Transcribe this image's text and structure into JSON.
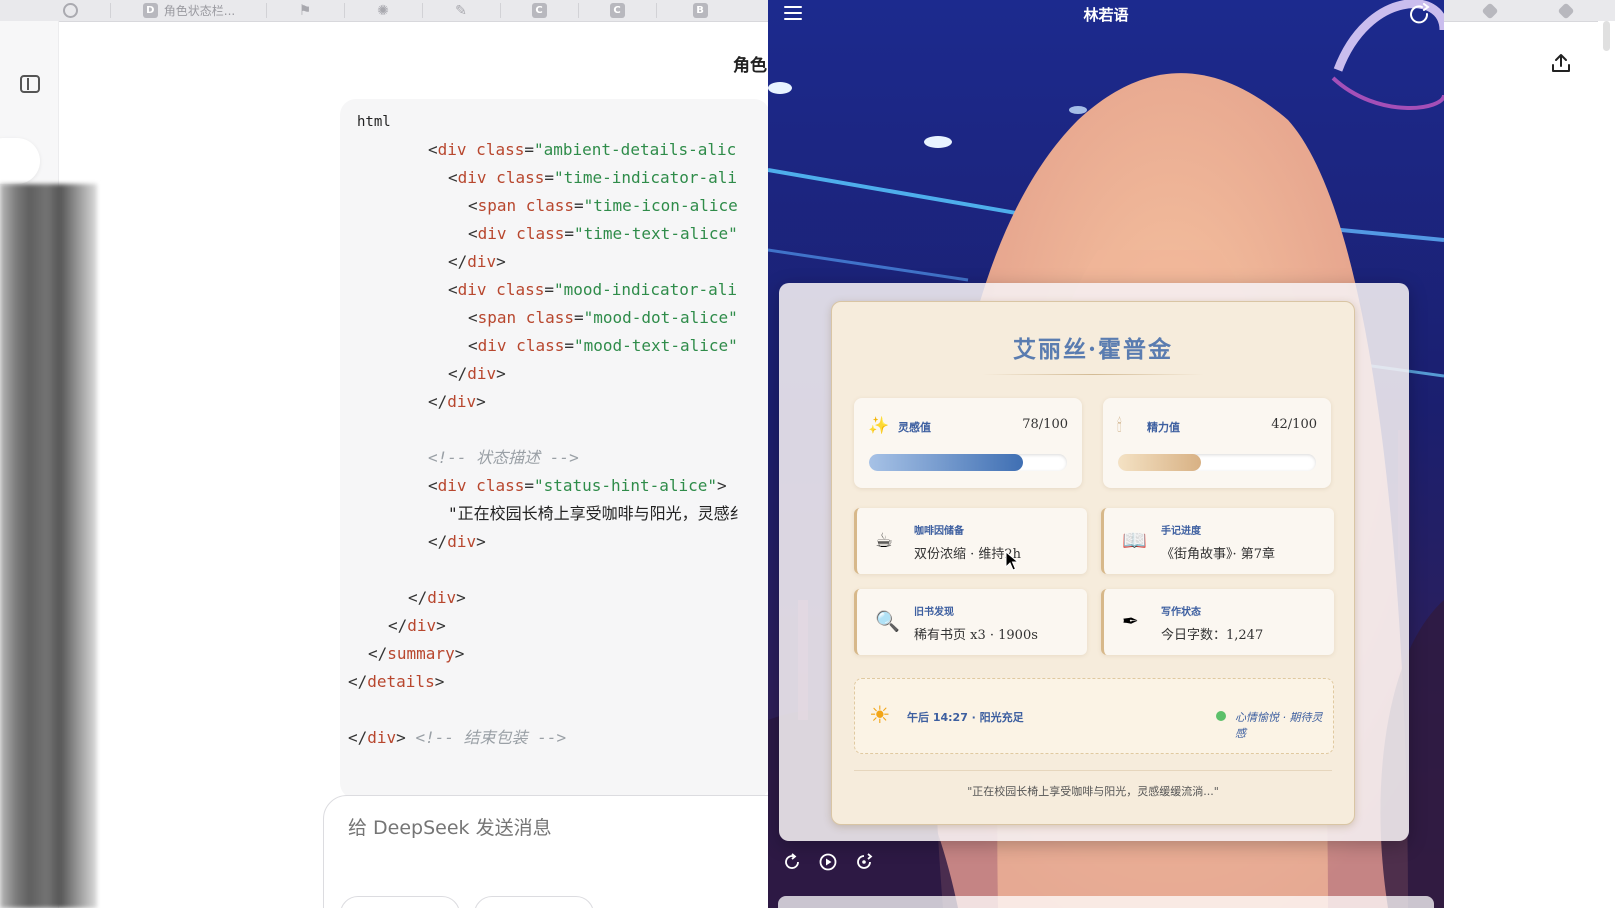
{
  "tabs": [
    {
      "icon": "openai-icon",
      "glyph": "",
      "label": ""
    },
    {
      "icon": "doc-tab-icon",
      "glyph": "D",
      "label": "角色状态栏..."
    },
    {
      "icon": "flag-icon",
      "glyph": "⚑",
      "label": ""
    },
    {
      "icon": "sparkle-icon",
      "glyph": "✺",
      "label": ""
    },
    {
      "icon": "app-icon",
      "glyph": "✎",
      "label": ""
    },
    {
      "icon": "c-tab-icon",
      "glyph": "C",
      "label": ""
    },
    {
      "icon": "c-tab-icon-2",
      "glyph": "C",
      "label": ""
    },
    {
      "icon": "b-tab-icon",
      "glyph": "B",
      "label": ""
    }
  ],
  "chat": {
    "title": "角色",
    "code_language": "html",
    "composer_placeholder": "给 DeepSeek 发送消息"
  },
  "code_lines": [
    {
      "indent": 4,
      "parts": [
        {
          "t": "punc",
          "v": "<"
        },
        {
          "t": "tag",
          "v": "div"
        },
        {
          "t": "attr",
          "v": " class"
        },
        {
          "t": "punc",
          "v": "="
        },
        {
          "t": "str",
          "v": "\"ambient-details-alic"
        }
      ]
    },
    {
      "indent": 5,
      "parts": [
        {
          "t": "punc",
          "v": "<"
        },
        {
          "t": "tag",
          "v": "div"
        },
        {
          "t": "attr",
          "v": " class"
        },
        {
          "t": "punc",
          "v": "="
        },
        {
          "t": "str",
          "v": "\"time-indicator-ali"
        }
      ]
    },
    {
      "indent": 6,
      "parts": [
        {
          "t": "punc",
          "v": "<"
        },
        {
          "t": "tag",
          "v": "span"
        },
        {
          "t": "attr",
          "v": " class"
        },
        {
          "t": "punc",
          "v": "="
        },
        {
          "t": "str",
          "v": "\"time-icon-alice"
        }
      ]
    },
    {
      "indent": 6,
      "parts": [
        {
          "t": "punc",
          "v": "<"
        },
        {
          "t": "tag",
          "v": "div"
        },
        {
          "t": "attr",
          "v": " class"
        },
        {
          "t": "punc",
          "v": "="
        },
        {
          "t": "str",
          "v": "\"time-text-alice\""
        }
      ]
    },
    {
      "indent": 5,
      "parts": [
        {
          "t": "punc",
          "v": "</"
        },
        {
          "t": "tag",
          "v": "div"
        },
        {
          "t": "punc",
          "v": ">"
        }
      ]
    },
    {
      "indent": 5,
      "parts": [
        {
          "t": "punc",
          "v": "<"
        },
        {
          "t": "tag",
          "v": "div"
        },
        {
          "t": "attr",
          "v": " class"
        },
        {
          "t": "punc",
          "v": "="
        },
        {
          "t": "str",
          "v": "\"mood-indicator-ali"
        }
      ]
    },
    {
      "indent": 6,
      "parts": [
        {
          "t": "punc",
          "v": "<"
        },
        {
          "t": "tag",
          "v": "span"
        },
        {
          "t": "attr",
          "v": " class"
        },
        {
          "t": "punc",
          "v": "="
        },
        {
          "t": "str",
          "v": "\"mood-dot-alice\""
        }
      ]
    },
    {
      "indent": 6,
      "parts": [
        {
          "t": "punc",
          "v": "<"
        },
        {
          "t": "tag",
          "v": "div"
        },
        {
          "t": "attr",
          "v": " class"
        },
        {
          "t": "punc",
          "v": "="
        },
        {
          "t": "str",
          "v": "\"mood-text-alice\""
        }
      ]
    },
    {
      "indent": 5,
      "parts": [
        {
          "t": "punc",
          "v": "</"
        },
        {
          "t": "tag",
          "v": "div"
        },
        {
          "t": "punc",
          "v": ">"
        }
      ]
    },
    {
      "indent": 4,
      "parts": [
        {
          "t": "punc",
          "v": "</"
        },
        {
          "t": "tag",
          "v": "div"
        },
        {
          "t": "punc",
          "v": ">"
        }
      ]
    },
    {
      "indent": 0,
      "parts": []
    },
    {
      "indent": 4,
      "parts": [
        {
          "t": "comment",
          "v": "<!-- 状态描述 -->"
        }
      ]
    },
    {
      "indent": 4,
      "parts": [
        {
          "t": "punc",
          "v": "<"
        },
        {
          "t": "tag",
          "v": "div"
        },
        {
          "t": "attr",
          "v": " class"
        },
        {
          "t": "punc",
          "v": "="
        },
        {
          "t": "str",
          "v": "\"status-hint-alice\""
        },
        {
          "t": "punc",
          "v": ">"
        }
      ]
    },
    {
      "indent": 5,
      "parts": [
        {
          "t": "text",
          "v": "\"正在校园长椅上享受咖啡与阳光，灵感纟"
        }
      ]
    },
    {
      "indent": 4,
      "parts": [
        {
          "t": "punc",
          "v": "</"
        },
        {
          "t": "tag",
          "v": "div"
        },
        {
          "t": "punc",
          "v": ">"
        }
      ]
    },
    {
      "indent": 0,
      "parts": []
    },
    {
      "indent": 3,
      "parts": [
        {
          "t": "punc",
          "v": "</"
        },
        {
          "t": "tag",
          "v": "div"
        },
        {
          "t": "punc",
          "v": ">"
        }
      ]
    },
    {
      "indent": 2,
      "parts": [
        {
          "t": "punc",
          "v": "</"
        },
        {
          "t": "tag",
          "v": "div"
        },
        {
          "t": "punc",
          "v": ">"
        }
      ]
    },
    {
      "indent": 1,
      "parts": [
        {
          "t": "punc",
          "v": "</"
        },
        {
          "t": "tag",
          "v": "summary"
        },
        {
          "t": "punc",
          "v": ">"
        }
      ]
    },
    {
      "indent": 0,
      "parts": [
        {
          "t": "punc",
          "v": "</"
        },
        {
          "t": "tag",
          "v": "details"
        },
        {
          "t": "punc",
          "v": ">"
        }
      ]
    },
    {
      "indent": 0,
      "parts": []
    },
    {
      "indent": 0,
      "parts": [
        {
          "t": "punc",
          "v": "</"
        },
        {
          "t": "tag",
          "v": "div"
        },
        {
          "t": "punc",
          "v": ">"
        },
        {
          "t": "comment",
          "v": " <!-- 结束包装 -->"
        }
      ]
    }
  ],
  "phone": {
    "title": "林若语",
    "card": {
      "name": "艾丽丝·霍普金",
      "stats": [
        {
          "icon": "sparkle-icon",
          "glyph": "✨",
          "label": "灵感值",
          "value_text": "78/100",
          "fraction": 0.78,
          "bar_from": "#a7c2e6",
          "bar_to": "#3f6fb3"
        },
        {
          "icon": "candle-icon",
          "glyph": "🕯",
          "label": "精力值",
          "value_text": "42/100",
          "fraction": 0.42,
          "bar_from": "#f4e2c4",
          "bar_to": "#d8b184"
        }
      ],
      "infos": [
        {
          "icon": "coffee-icon",
          "glyph": "☕",
          "title": "咖啡因储备",
          "text": "双份浓缩 · 维持2h"
        },
        {
          "icon": "book-icon",
          "glyph": "📖",
          "title": "手记进度",
          "text": "《街角故事》· 第7章"
        },
        {
          "icon": "magnifier-icon",
          "glyph": "🔍",
          "title": "旧书发现",
          "text": "稀有书页 x3 · 1900s"
        },
        {
          "icon": "pen-icon",
          "glyph": "✒",
          "title": "写作状态",
          "text": "今日字数：1,247"
        }
      ],
      "ambient": {
        "time_text": "午后 14:27 · 阳光充足",
        "mood_text": "心情愉悦 · 期待灵感",
        "mood_color": "#5cc06a"
      },
      "status_hint": "\"正在校园长椅上享受咖啡与阳光，灵感缓缓流淌...\""
    }
  }
}
